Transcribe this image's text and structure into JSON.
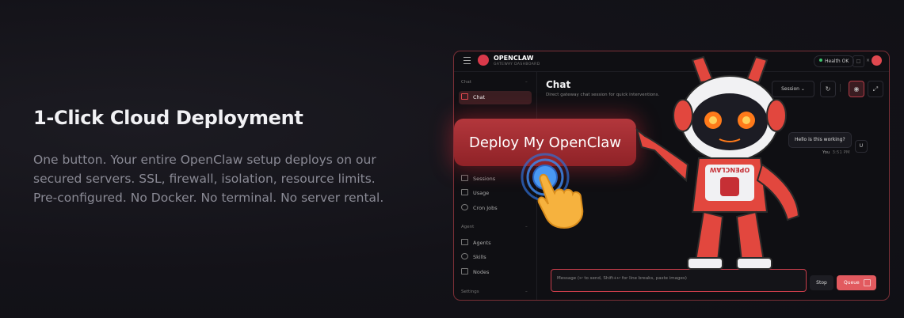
{
  "feature": {
    "title": "1-Click Cloud Deployment",
    "description": "One button. Your entire OpenClaw setup deploys on our secured servers. SSL, firewall, isolation, resource limits. Pre-configured. No Docker. No terminal. No server rental."
  },
  "app": {
    "brand": "OPENCLAW",
    "brand_sub": "GATEWAY DASHBOARD",
    "health": "Health OK"
  },
  "sidebar": {
    "sections": {
      "chat": "Chat",
      "agent": "Agent",
      "settings": "Settings"
    },
    "items": [
      {
        "label": "Chat",
        "icon": "message-icon",
        "active": true
      },
      {
        "label": "Sessions",
        "icon": "file-icon"
      },
      {
        "label": "Usage",
        "icon": "bar-chart-icon"
      },
      {
        "label": "Cron Jobs",
        "icon": "clock-icon"
      },
      {
        "label": "Agents",
        "icon": "folder-icon"
      },
      {
        "label": "Skills",
        "icon": "sparkle-icon"
      },
      {
        "label": "Nodes",
        "icon": "monitor-icon"
      }
    ]
  },
  "chat": {
    "title": "Chat",
    "subtitle": "Direct gateway chat session for quick interventions.",
    "session_select": "Session",
    "message": {
      "text": "Hello is this working?",
      "sender": "You",
      "time": "3:51 PM",
      "avatar": "U"
    },
    "input_placeholder": "Message (↩ to send, Shift+↩ for line breaks, paste images)",
    "stop_label": "Stop",
    "queue_label": "Queue"
  },
  "overlay": {
    "button_label": "Deploy My OpenClaw"
  },
  "robot": {
    "chest_text": "OPENCLAW"
  },
  "colors": {
    "accent": "#e25a5f",
    "border": "#7a2f36",
    "background": "#131218"
  }
}
